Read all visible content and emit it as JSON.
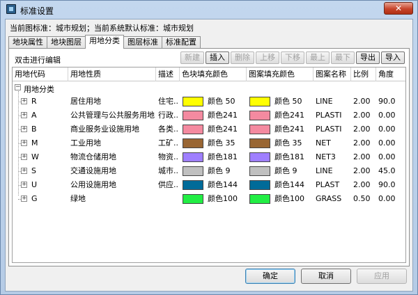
{
  "window": {
    "title": "标准设置",
    "close_label": "✕"
  },
  "current_standard": "当前图标准：城市规划；当前系统默认标准：城市规划",
  "tabs": [
    {
      "label": "地块属性"
    },
    {
      "label": "地块图层"
    },
    {
      "label": "用地分类",
      "active": true
    },
    {
      "label": "图层标准"
    },
    {
      "label": "标准配置"
    }
  ],
  "panel": {
    "hint": "双击进行编辑"
  },
  "toolbar": [
    {
      "label": "新建",
      "enabled": false
    },
    {
      "label": "插入",
      "enabled": true
    },
    {
      "label": "删除",
      "enabled": false
    },
    {
      "label": "上移",
      "enabled": false
    },
    {
      "label": "下移",
      "enabled": false
    },
    {
      "label": "最上",
      "enabled": false
    },
    {
      "label": "最下",
      "enabled": false
    },
    {
      "label": "导出",
      "enabled": true
    },
    {
      "label": "导入",
      "enabled": true
    }
  ],
  "table": {
    "headers": [
      "用地代码",
      "用地性质",
      "描述",
      "色块填充颜色",
      "图案填充颜色",
      "图案名称",
      "比例",
      "角度"
    ],
    "group": {
      "expander": "−",
      "label": "用地分类"
    },
    "rows": [
      {
        "code": "R",
        "name": "居住用地",
        "desc": "住宅...",
        "fill_color": "#ffff00",
        "fill_label": "颜色 50",
        "pattern_color": "#ffff00",
        "pattern_label": "颜色 50",
        "pattern": "LINE",
        "scale": "2.00",
        "angle": "90.0"
      },
      {
        "code": "A",
        "name": "公共管理与公共服务用地",
        "desc": "行政...",
        "fill_color": "#f48aa0",
        "fill_label": "颜色241",
        "pattern_color": "#f48aa0",
        "pattern_label": "颜色241",
        "pattern": "PLASTI",
        "scale": "2.00",
        "angle": "0.00"
      },
      {
        "code": "B",
        "name": "商业服务业设施用地",
        "desc": "各类...",
        "fill_color": "#f48aa0",
        "fill_label": "颜色241",
        "pattern_color": "#f48aa0",
        "pattern_label": "颜色241",
        "pattern": "PLASTI",
        "scale": "2.00",
        "angle": "0.00"
      },
      {
        "code": "M",
        "name": "工业用地",
        "desc": "工矿...",
        "fill_color": "#996633",
        "fill_label": "颜色 35",
        "pattern_color": "#996633",
        "pattern_label": "颜色 35",
        "pattern": "NET",
        "scale": "2.00",
        "angle": "0.00"
      },
      {
        "code": "W",
        "name": "物流仓储用地",
        "desc": "物资...",
        "fill_color": "#9f7fff",
        "fill_label": "颜色181",
        "pattern_color": "#9f7fff",
        "pattern_label": "颜色181",
        "pattern": "NET3",
        "scale": "2.00",
        "angle": "0.00"
      },
      {
        "code": "S",
        "name": "交通设施用地",
        "desc": "城市...",
        "fill_color": "#c0c0c0",
        "fill_label": "颜色  9",
        "pattern_color": "#c0c0c0",
        "pattern_label": "颜色  9",
        "pattern": "LINE",
        "scale": "2.00",
        "angle": "45.0"
      },
      {
        "code": "U",
        "name": "公用设施用地",
        "desc": "供应...",
        "fill_color": "#006b99",
        "fill_label": "颜色144",
        "pattern_color": "#006b99",
        "pattern_label": "颜色144",
        "pattern": "PLAST",
        "scale": "2.00",
        "angle": "90.0"
      },
      {
        "code": "G",
        "name": "绿地",
        "desc": "",
        "fill_color": "#22ee44",
        "fill_label": "颜色100",
        "pattern_color": "#22ee44",
        "pattern_label": "颜色100",
        "pattern": "GRASS",
        "scale": "0.50",
        "angle": "0.00"
      }
    ]
  },
  "buttons": [
    {
      "label": "确定",
      "enabled": true,
      "default": true
    },
    {
      "label": "取消",
      "enabled": true
    },
    {
      "label": "应用",
      "enabled": false
    }
  ]
}
